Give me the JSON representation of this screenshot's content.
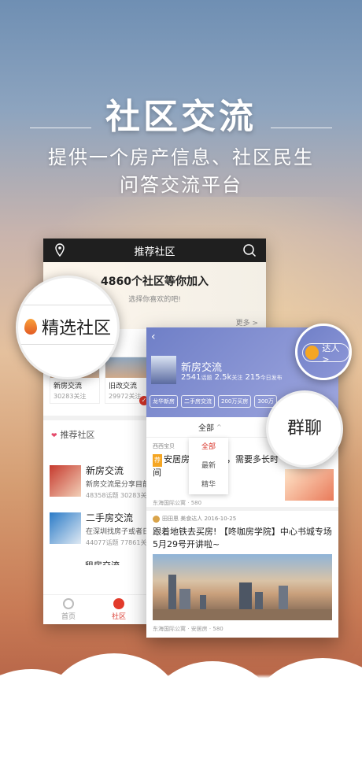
{
  "hero": {
    "title": "社区交流",
    "subtitle_line1": "提供一个房产信息、社区民生",
    "subtitle_line2": "问答交流平台"
  },
  "back_phone": {
    "header_title": "推荐社区",
    "banner_title": "4860个社区等你加入",
    "banner_subtitle": "选择你喜欢的吧!",
    "more": "更多 >",
    "cards": [
      {
        "name": "新房交流",
        "count": "30283关注"
      },
      {
        "name": "旧改交流",
        "count": "29972关注"
      }
    ],
    "section_title": "推荐社区",
    "items": [
      {
        "title": "新房交流",
        "desc": "新房交流是分享目前",
        "stats": "48358话题  30283关"
      },
      {
        "title": "二手房交流",
        "desc": "在深圳找房子或者日",
        "stats": "44077话题  77861关"
      }
    ],
    "item3_title": "租房交流",
    "tabs": [
      {
        "label": "首页"
      },
      {
        "label": "社区"
      }
    ]
  },
  "magnifier_left": {
    "label": "精选社区"
  },
  "front_phone": {
    "community_name": "新房交流",
    "stats": {
      "topics": "2541",
      "topics_unit": "话题",
      "follows": "2.5k",
      "follows_unit": "关注",
      "today": "215",
      "today_unit": "今日发布"
    },
    "tags": [
      "龙华新房",
      "二手房交流",
      "200万买房",
      "300万"
    ],
    "filter_label": "全部",
    "dropdown": [
      "全部",
      "最新",
      "精华"
    ],
    "post1": {
      "user": "西西宝贝",
      "badge": "荐",
      "text": "安居房... 料审核，需要多长时间",
      "meta_location": "东海国际公寓",
      "meta_comments": "580"
    },
    "post2": {
      "user": "田田恩",
      "user_tag": "美食达人",
      "date": "2016-10-25",
      "text": "跟着地铁去买房! 【咚咖房学院】中心书城专场5月29号开讲啦~",
      "meta_location": "东海国际公寓",
      "meta_tag": "安居房",
      "meta_comments": "580"
    }
  },
  "magnifier_daren": {
    "label": "达人 >"
  },
  "magnifier_qunliao": {
    "label": "群聊"
  }
}
